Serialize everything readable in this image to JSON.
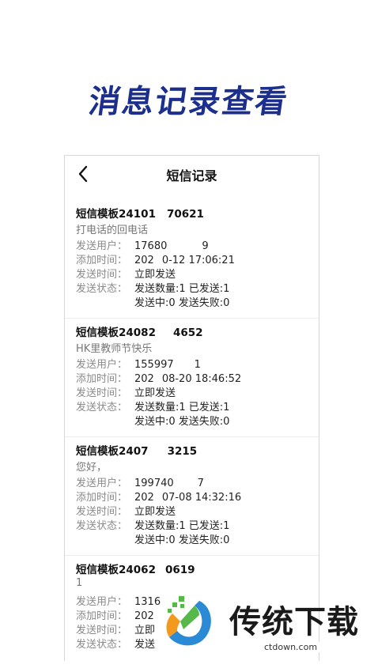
{
  "hero_title": "消息记录查看",
  "screen": {
    "title": "短信记录",
    "back_icon": "chevron-left-icon"
  },
  "records": [
    {
      "title": "短信模板24101",
      "title_tail": "70621",
      "desc": "打电话的回电话",
      "user_label": "发送用户：",
      "user": "17680",
      "user_tail": "9",
      "added_label": "添加时间：",
      "added": "202",
      "added_tail": "0-12 17:06:21",
      "time_label": "发送时间：",
      "time": "立即发送",
      "status_label": "发送状态：",
      "status_line1": "发送数量:1  已发送:1",
      "status_line2": "发送中:0  发送失败:0"
    },
    {
      "title": "短信模板24082",
      "title_tail": "4652",
      "desc": "HK里教师节快乐",
      "user_label": "发送用户：",
      "user": "155997",
      "user_tail": "1",
      "added_label": "添加时间：",
      "added": "202",
      "added_tail": "08-20 18:46:52",
      "time_label": "发送时间：",
      "time": "立即发送",
      "status_label": "发送状态：",
      "status_line1": "发送数量:1  已发送:1",
      "status_line2": "发送中:0  发送失败:0"
    },
    {
      "title": "短信模板2407",
      "title_tail": "3215",
      "desc": "您好，",
      "user_label": "发送用户：",
      "user": "199740",
      "user_tail": "7",
      "added_label": "添加时间：",
      "added": "202",
      "added_tail": "07-08 14:32:16",
      "time_label": "发送时间：",
      "time": "立即发送",
      "status_label": "发送状态：",
      "status_line1": "发送数量:1  已发送:1",
      "status_line2": "发送中:0  发送失败:0"
    },
    {
      "title": "短信模板24062",
      "title_tail": "0619",
      "desc": "1",
      "user_label": "发送用户：",
      "user": "1316",
      "user_tail": "",
      "added_label": "添加时间：",
      "added": "202",
      "added_tail": "",
      "time_label": "发送时间：",
      "time": "立即",
      "status_label": "发送状态：",
      "status_line1": "发送",
      "status_line2": ""
    }
  ],
  "watermark": {
    "name": "传统下载",
    "url": "ctdown.com",
    "colors": {
      "green": "#55b848",
      "orange": "#f39a1e",
      "blue": "#2a8ad6"
    }
  }
}
